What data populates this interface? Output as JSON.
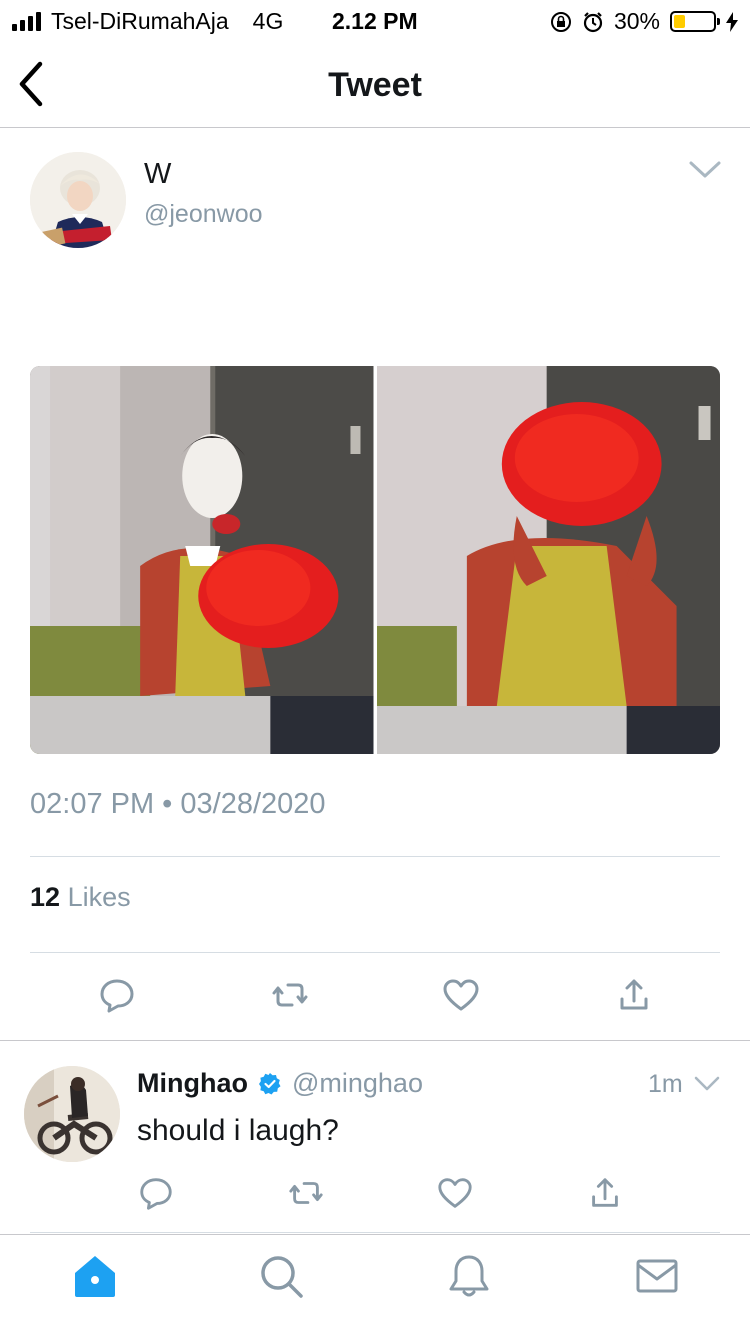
{
  "status_bar": {
    "carrier": "Tsel-DiRumahAja",
    "network": "4G",
    "time": "2.12 PM",
    "battery": "30%",
    "battery_level": 0.3
  },
  "nav": {
    "title": "Tweet"
  },
  "tweet": {
    "display_name": "W",
    "handle": "@jeonwoo",
    "timestamp": "02:07 PM • 03/28/2020",
    "likes_count": "12",
    "likes_label": "Likes"
  },
  "reply": {
    "display_name": "Minghao",
    "handle": "@minghao",
    "time": "1m",
    "text": "should i laugh?"
  },
  "colors": {
    "accent": "#1da1f2",
    "secondary_text": "#8899a6",
    "icon_gray": "#8899a6",
    "battery_fill": "#ffcc00"
  }
}
